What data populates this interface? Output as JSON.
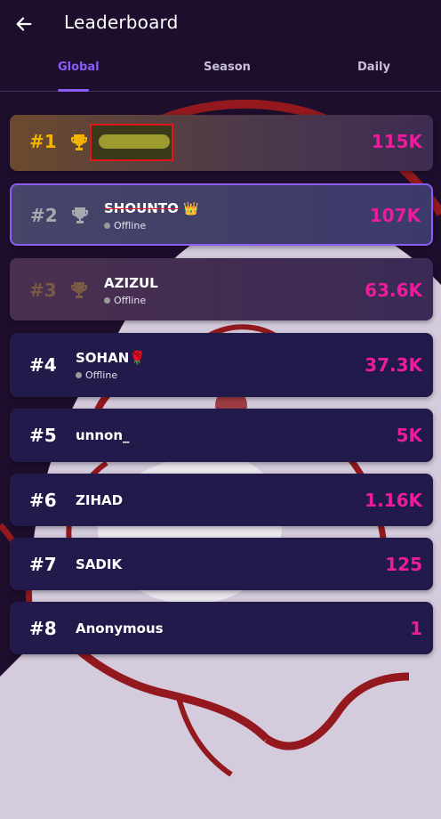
{
  "header": {
    "title": "Leaderboard",
    "back_icon": "arrow-left-icon"
  },
  "tabs": [
    {
      "label": "Global",
      "active": true
    },
    {
      "label": "Season",
      "active": false
    },
    {
      "label": "Daily",
      "active": false
    }
  ],
  "colors": {
    "accent": "#8b5cf6",
    "score": "#ec1c9c",
    "gold": "#f5b301",
    "silver": "#a8a8b0",
    "bronze": "#7a5a44"
  },
  "entries": [
    {
      "rank": "#1",
      "name": "",
      "status": "",
      "score": "115K",
      "trophy": "gold-trophy-icon"
    },
    {
      "rank": "#2",
      "name": "SHOUNTO",
      "badge": "👑",
      "status": "Offline",
      "score": "107K",
      "trophy": "silver-trophy-icon"
    },
    {
      "rank": "#3",
      "name": "AZIZUL",
      "status": "Offline",
      "score": "63.6K",
      "trophy": "bronze-trophy-icon"
    },
    {
      "rank": "#4",
      "name": "SOHAN",
      "badge": "🌹",
      "status": "Offline",
      "score": "37.3K"
    },
    {
      "rank": "#5",
      "name": "unnon_",
      "score": "5K"
    },
    {
      "rank": "#6",
      "name": "ZIHAD",
      "score": "1.16K"
    },
    {
      "rank": "#7",
      "name": "SADIK",
      "score": "125"
    },
    {
      "rank": "#8",
      "name": "Anonymous",
      "score": "1"
    }
  ]
}
